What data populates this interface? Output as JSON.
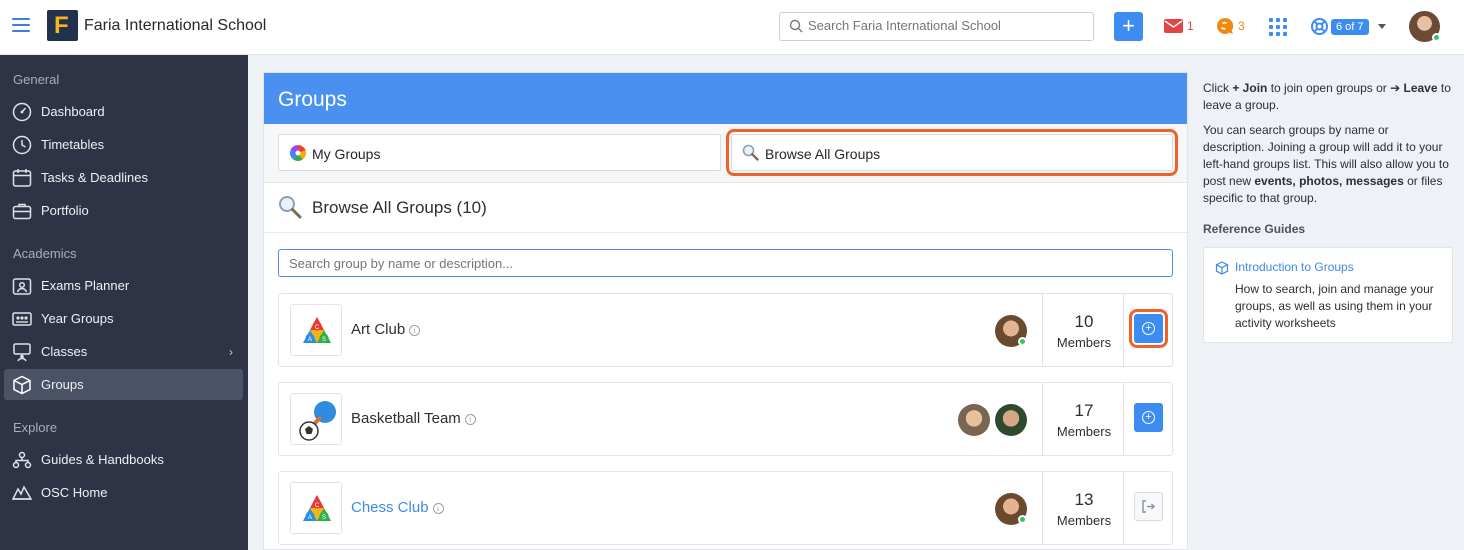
{
  "topbar": {
    "school_name": "Faria International School",
    "logo_letter": "F",
    "search_placeholder": "Search Faria International School",
    "add_label": "+",
    "mail_count": "1",
    "chat_count": "3",
    "help_pill": "6 of 7"
  },
  "sidebar": {
    "sections": [
      {
        "heading": "General"
      },
      {
        "heading": "Academics"
      },
      {
        "heading": "Explore"
      }
    ],
    "items": [
      {
        "label": "Dashboard",
        "icon": "dashboard-icon"
      },
      {
        "label": "Timetables",
        "icon": "clock-icon"
      },
      {
        "label": "Tasks & Deadlines",
        "icon": "calendar-icon"
      },
      {
        "label": "Portfolio",
        "icon": "briefcase-icon"
      },
      {
        "label": "Exams Planner",
        "icon": "exams-icon"
      },
      {
        "label": "Year Groups",
        "icon": "year-groups-icon"
      },
      {
        "label": "Classes",
        "icon": "classes-icon",
        "chevron": "›"
      },
      {
        "label": "Groups",
        "icon": "cube-icon",
        "active": true
      },
      {
        "label": "Guides & Handbooks",
        "icon": "guides-icon"
      },
      {
        "label": "OSC Home",
        "icon": "osc-icon"
      }
    ]
  },
  "main": {
    "title": "Groups",
    "tabs": [
      {
        "label": "My Groups"
      },
      {
        "label": "Browse All Groups"
      }
    ],
    "browse_heading": "Browse All Groups (10)",
    "group_search_placeholder": "Search group by name or description...",
    "groups": [
      {
        "name": "Art Club",
        "count": "10",
        "members_label": "Members",
        "action": "join"
      },
      {
        "name": "Basketball Team",
        "count": "17",
        "members_label": "Members",
        "action": "join"
      },
      {
        "name": "Chess Club",
        "count": "13",
        "members_label": "Members",
        "action": "leave"
      }
    ],
    "info_glyph": "i",
    "join_glyph": "+"
  },
  "right_panel": {
    "intro_pre": "Click ",
    "intro_join": "+ Join",
    "intro_mid": " to join open groups or ",
    "intro_leave": "➔ Leave",
    "intro_post": " to leave a group.",
    "para2_pre": "You can search groups by name or description. Joining a group will add it to your left-hand groups list. This will also allow you to post new ",
    "para2_bold": "events, photos, messages",
    "para2_post": " or files specific to that group.",
    "ref_heading": "Reference Guides",
    "ref_title": "Introduction to Groups",
    "ref_desc": "How to search, join and manage your groups, as well as using them in your activity worksheets"
  },
  "colors": {
    "accent": "#4a90f0",
    "sidebar_bg": "#2e3445",
    "highlight": "#f0622b",
    "mail": "#e64444",
    "chat": "#f08a16",
    "online": "#2ec866"
  }
}
